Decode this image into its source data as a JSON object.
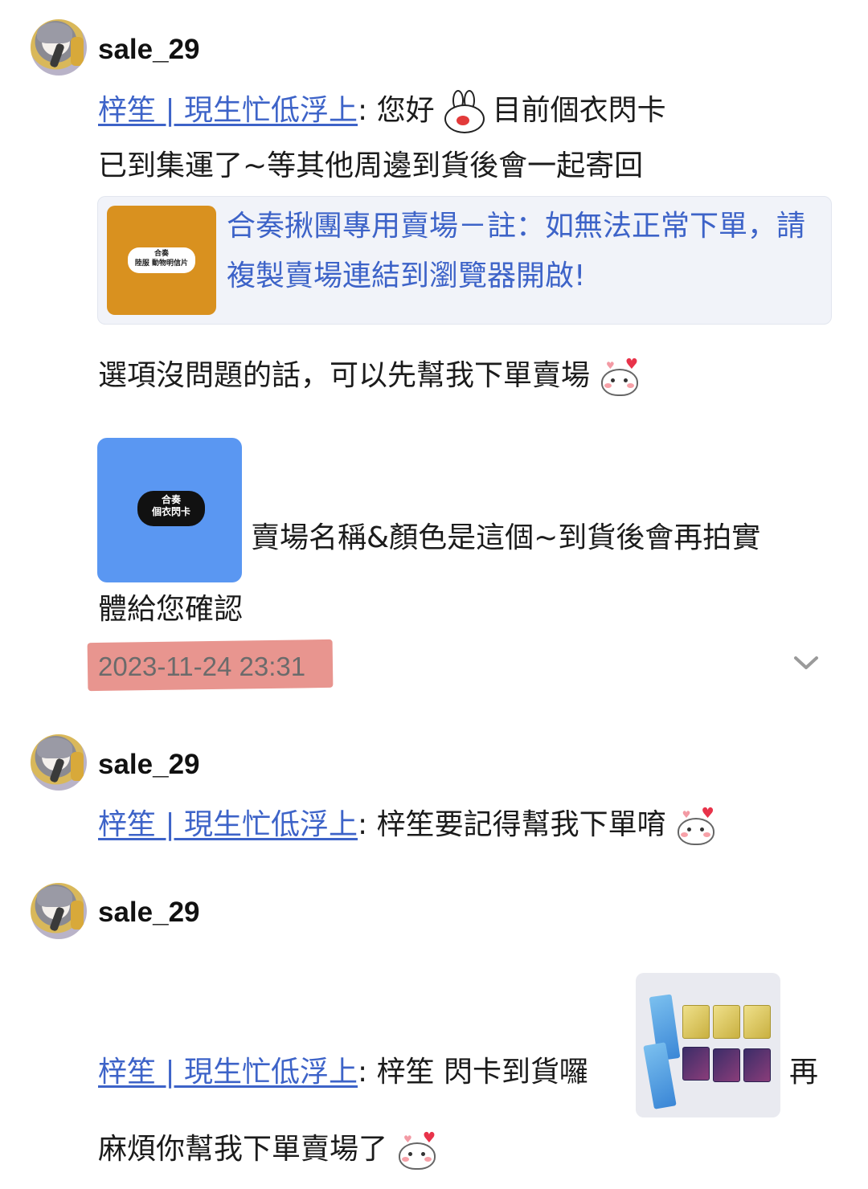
{
  "messages": [
    {
      "username": "sale_29",
      "sender_link": "梓笙 | 現生忙低浮上",
      "line1_text": ": 您好",
      "line1_after": "目前個衣閃卡",
      "line2": "已到集運了~等其他周邊到貨後會一起寄回",
      "link_card": {
        "title": "合奏揪團專用賣場－註：如無法正常下單，請複製賣場連結到瀏覽器開啟!",
        "thumb_line1": "合奏",
        "thumb_line2": "陸服 動物明信片"
      },
      "line3": "選項沒問題的話，可以先幫我下單賣場",
      "image_card": {
        "line1": "合奏",
        "line2": "個衣閃卡"
      },
      "line4": "賣場名稱&顏色是這個~到貨後會再拍實",
      "line5": "體給您確認",
      "timestamp": "2023-11-24 23:31"
    },
    {
      "username": "sale_29",
      "sender_link": "梓笙 | 現生忙低浮上",
      "text": ": 梓笙要記得幫我下單唷"
    },
    {
      "username": "sale_29",
      "sender_link": "梓笙 | 現生忙低浮上",
      "text": ": 梓笙 閃卡到貨囉",
      "after_image": "再",
      "line2": "麻煩你幫我下單賣場了"
    }
  ],
  "icons": {
    "avatar": "avatar-icon",
    "rabbit": "rabbit-emoji-icon",
    "cat_heart": "cat-heart-emoji-icon",
    "expand": "chevron-down-icon"
  },
  "colors": {
    "link": "#3d63c8",
    "highlight": "#e8958f",
    "thumb_orange": "#d9911f",
    "thumb_blue": "#5a97f2"
  }
}
